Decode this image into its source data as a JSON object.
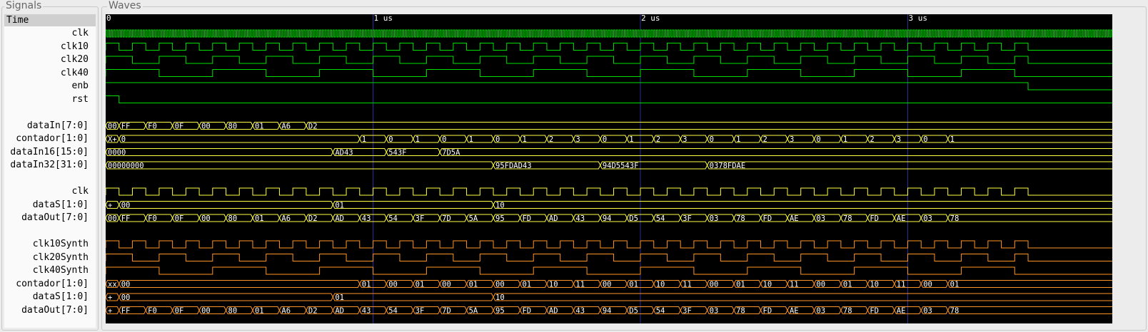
{
  "signals_title": "Signals",
  "waves_title": "Waves",
  "time_label": "Time",
  "time_markers": [
    "0",
    "1 us",
    "2 us",
    "3 us"
  ],
  "colors": {
    "green": "#00e000",
    "yellow": "#ffff44",
    "orange": "#ff9422",
    "cursor": "#2d2d9a",
    "background": "#000000"
  },
  "signals": [
    {
      "name": "clk",
      "slot": 1,
      "type": "clock",
      "period_units": 10,
      "end": null,
      "color": "green"
    },
    {
      "name": "clk10",
      "slot": 2,
      "type": "clock",
      "period_units": 100,
      "end": 3450,
      "color": "green"
    },
    {
      "name": "clk20",
      "slot": 3,
      "type": "clock",
      "period_units": 200,
      "end": 3450,
      "color": "green"
    },
    {
      "name": "clk40",
      "slot": 4,
      "type": "clock",
      "period_units": 400,
      "end": 3450,
      "color": "green"
    },
    {
      "name": "enb",
      "slot": 5,
      "type": "bit",
      "edges": [
        [
          0,
          1
        ],
        [
          3450,
          0
        ]
      ],
      "color": "green"
    },
    {
      "name": "rst",
      "slot": 6,
      "type": "bit",
      "edges": [
        [
          0,
          1
        ],
        [
          50,
          0
        ]
      ],
      "color": "green"
    },
    {
      "name": "dataIn[7:0]",
      "slot": 8,
      "type": "bus",
      "color": "yellow",
      "segments": [
        [
          "00",
          0
        ],
        [
          "FF",
          50
        ],
        [
          "F0",
          150
        ],
        [
          "0F",
          250
        ],
        [
          "00",
          350
        ],
        [
          "80",
          450
        ],
        [
          "01",
          550
        ],
        [
          "A6",
          650
        ],
        [
          "D2",
          750
        ]
      ]
    },
    {
      "name": "contador[1:0]",
      "slot": 9,
      "type": "bus",
      "color": "yellow",
      "segments": [
        [
          "X+",
          0
        ],
        [
          "0",
          50
        ],
        [
          "1",
          950
        ],
        [
          "0",
          1050
        ],
        [
          "1",
          1150
        ],
        [
          "0",
          1250
        ],
        [
          "1",
          1350
        ],
        [
          "0",
          1450
        ],
        [
          "1",
          1550
        ],
        [
          "2",
          1650
        ],
        [
          "3",
          1750
        ],
        [
          "0",
          1850
        ],
        [
          "1",
          1950
        ],
        [
          "2",
          2050
        ],
        [
          "3",
          2150
        ],
        [
          "0",
          2250
        ],
        [
          "1",
          2350
        ],
        [
          "2",
          2450
        ],
        [
          "3",
          2550
        ],
        [
          "0",
          2650
        ],
        [
          "1",
          2750
        ],
        [
          "2",
          2850
        ],
        [
          "3",
          2950
        ],
        [
          "0",
          3050
        ],
        [
          "1",
          3150
        ]
      ]
    },
    {
      "name": "dataIn16[15:0]",
      "slot": 10,
      "type": "bus",
      "color": "yellow",
      "segments": [
        [
          "0000",
          0
        ],
        [
          "AD43",
          850
        ],
        [
          "543F",
          1050
        ],
        [
          "7D5A",
          1250
        ]
      ]
    },
    {
      "name": "dataIn32[31:0]",
      "slot": 11,
      "type": "bus",
      "color": "yellow",
      "segments": [
        [
          "00000000",
          0
        ],
        [
          "95FDAD43",
          1450
        ],
        [
          "94D5543F",
          1850
        ],
        [
          "0378FDAE",
          2250
        ]
      ]
    },
    {
      "name": "clk",
      "slot": 13,
      "type": "clock",
      "period_units": 100,
      "end": 3450,
      "color": "yellow"
    },
    {
      "name": "dataS[1:0]",
      "slot": 14,
      "type": "bus",
      "color": "yellow",
      "segments": [
        [
          "+",
          0
        ],
        [
          "00",
          50
        ],
        [
          "01",
          850
        ],
        [
          "10",
          1450
        ]
      ]
    },
    {
      "name": "dataOut[7:0]",
      "slot": 15,
      "type": "bus",
      "color": "yellow",
      "segments": [
        [
          "00",
          0
        ],
        [
          "FF",
          50
        ],
        [
          "F0",
          150
        ],
        [
          "0F",
          250
        ],
        [
          "00",
          350
        ],
        [
          "80",
          450
        ],
        [
          "01",
          550
        ],
        [
          "A6",
          650
        ],
        [
          "D2",
          750
        ],
        [
          "AD",
          850
        ],
        [
          "43",
          950
        ],
        [
          "54",
          1050
        ],
        [
          "3F",
          1150
        ],
        [
          "7D",
          1250
        ],
        [
          "5A",
          1350
        ],
        [
          "95",
          1450
        ],
        [
          "FD",
          1550
        ],
        [
          "AD",
          1650
        ],
        [
          "43",
          1750
        ],
        [
          "94",
          1850
        ],
        [
          "D5",
          1950
        ],
        [
          "54",
          2050
        ],
        [
          "3F",
          2150
        ],
        [
          "03",
          2250
        ],
        [
          "78",
          2350
        ],
        [
          "FD",
          2450
        ],
        [
          "AE",
          2550
        ],
        [
          "03",
          2650
        ],
        [
          "78",
          2750
        ],
        [
          "FD",
          2850
        ],
        [
          "AE",
          2950
        ],
        [
          "03",
          3050
        ],
        [
          "78",
          3150
        ]
      ]
    },
    {
      "name": "clk10Synth",
      "slot": 17,
      "type": "clock",
      "period_units": 100,
      "end": 3450,
      "color": "orange"
    },
    {
      "name": "clk20Synth",
      "slot": 18,
      "type": "clock",
      "period_units": 200,
      "end": 3450,
      "color": "orange"
    },
    {
      "name": "clk40Synth",
      "slot": 19,
      "type": "clock",
      "period_units": 400,
      "end": 3450,
      "color": "orange"
    },
    {
      "name": "contador[1:0]",
      "slot": 20,
      "type": "bus",
      "color": "orange",
      "segments": [
        [
          "xx",
          0
        ],
        [
          "00",
          50
        ],
        [
          "01",
          950
        ],
        [
          "00",
          1050
        ],
        [
          "01",
          1150
        ],
        [
          "00",
          1250
        ],
        [
          "01",
          1350
        ],
        [
          "00",
          1450
        ],
        [
          "01",
          1550
        ],
        [
          "10",
          1650
        ],
        [
          "11",
          1750
        ],
        [
          "00",
          1850
        ],
        [
          "01",
          1950
        ],
        [
          "10",
          2050
        ],
        [
          "11",
          2150
        ],
        [
          "00",
          2250
        ],
        [
          "01",
          2350
        ],
        [
          "10",
          2450
        ],
        [
          "11",
          2550
        ],
        [
          "00",
          2650
        ],
        [
          "01",
          2750
        ],
        [
          "10",
          2850
        ],
        [
          "11",
          2950
        ],
        [
          "00",
          3050
        ],
        [
          "01",
          3150
        ]
      ]
    },
    {
      "name": "dataS[1:0]",
      "slot": 21,
      "type": "bus",
      "color": "orange",
      "segments": [
        [
          "+",
          0
        ],
        [
          "00",
          50
        ],
        [
          "01",
          850
        ],
        [
          "10",
          1450
        ]
      ]
    },
    {
      "name": "dataOut[7:0]",
      "slot": 22,
      "type": "bus",
      "color": "orange",
      "segments": [
        [
          "+",
          0
        ],
        [
          "FF",
          50
        ],
        [
          "F0",
          150
        ],
        [
          "0F",
          250
        ],
        [
          "00",
          350
        ],
        [
          "80",
          450
        ],
        [
          "01",
          550
        ],
        [
          "A6",
          650
        ],
        [
          "D2",
          750
        ],
        [
          "AD",
          850
        ],
        [
          "43",
          950
        ],
        [
          "54",
          1050
        ],
        [
          "3F",
          1150
        ],
        [
          "7D",
          1250
        ],
        [
          "5A",
          1350
        ],
        [
          "95",
          1450
        ],
        [
          "FD",
          1550
        ],
        [
          "AD",
          1650
        ],
        [
          "43",
          1750
        ],
        [
          "94",
          1850
        ],
        [
          "D5",
          1950
        ],
        [
          "54",
          2050
        ],
        [
          "3F",
          2150
        ],
        [
          "03",
          2250
        ],
        [
          "78",
          2350
        ],
        [
          "FD",
          2450
        ],
        [
          "AE",
          2550
        ],
        [
          "03",
          2650
        ],
        [
          "78",
          2750
        ],
        [
          "FD",
          2850
        ],
        [
          "AE",
          2950
        ],
        [
          "03",
          3050
        ],
        [
          "78",
          3150
        ]
      ]
    }
  ]
}
